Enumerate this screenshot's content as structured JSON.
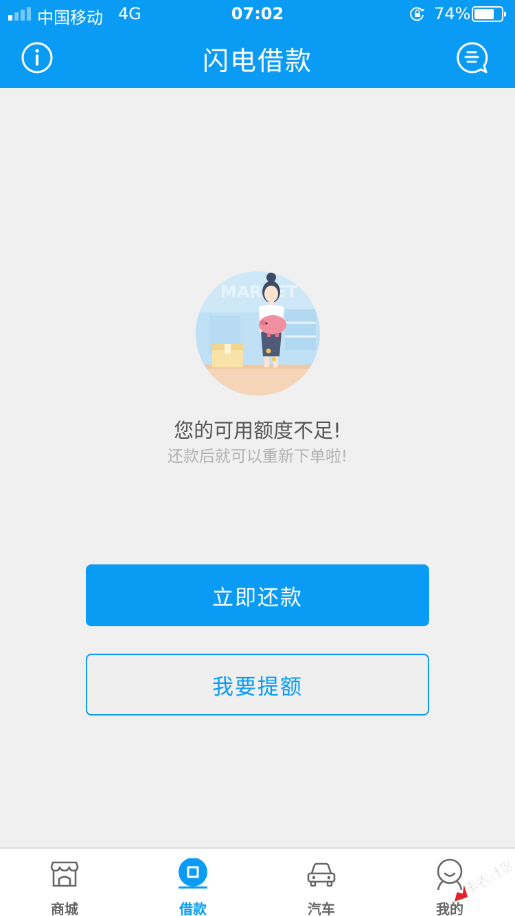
{
  "status_bar": {
    "carrier": "中国移动",
    "network": "4G",
    "time": "07:02",
    "battery_percent": "74%",
    "battery_level": 0.74,
    "signal_bars_active": 1,
    "icons": [
      "signal-icon",
      "rotation-lock-icon",
      "battery-icon"
    ]
  },
  "header": {
    "title": "闪电借款",
    "left_icon": "info-icon",
    "right_icon": "chat-bubble-icon"
  },
  "empty_state": {
    "illustration_text": "MARKET",
    "title": "您的可用额度不足!",
    "subtitle": "还款后就可以重新下单啦!"
  },
  "actions": {
    "repay_label": "立即还款",
    "raise_limit_label": "我要提额"
  },
  "tabbar": {
    "active_index": 1,
    "items": [
      {
        "label": "商城",
        "icon": "store-icon"
      },
      {
        "label": "借款",
        "icon": "loan-icon"
      },
      {
        "label": "汽车",
        "icon": "car-icon"
      },
      {
        "label": "我的",
        "icon": "profile-icon"
      }
    ]
  },
  "watermark": {
    "text": "卡农社区"
  },
  "colors": {
    "brand_blue": "#0a9bf5",
    "background": "#f0f0f0",
    "tab_inactive": "#666666"
  }
}
